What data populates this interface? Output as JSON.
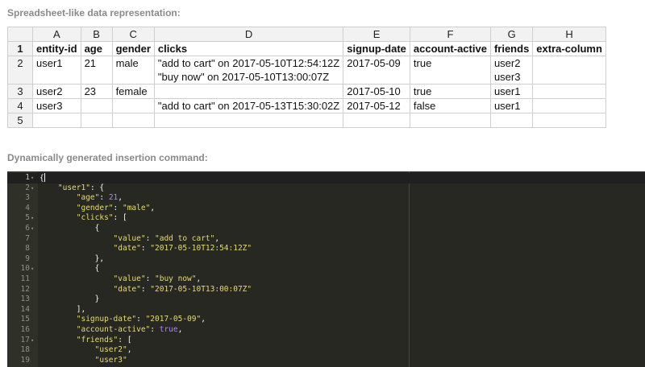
{
  "section1_title": "Spreadsheet-like data representation:",
  "section2_title": "Dynamically generated insertion command:",
  "spreadsheet": {
    "columns": [
      "A",
      "B",
      "C",
      "D",
      "E",
      "F",
      "G",
      "H"
    ],
    "rows": [
      {
        "num": "1",
        "cells": [
          "entity-id",
          "age",
          "gender",
          "clicks",
          "signup-date",
          "account-active",
          "friends",
          "extra-column"
        ]
      },
      {
        "num": "2",
        "cells": [
          "user1",
          "21",
          "male",
          "\"add to cart\" on 2017-05-10T12:54:12Z\n\"buy now\" on 2017-05-10T13:00:07Z",
          "2017-05-09",
          "true",
          "user2\nuser3",
          ""
        ]
      },
      {
        "num": "3",
        "cells": [
          "user2",
          "23",
          "female",
          "",
          "2017-05-10",
          "true",
          "user1",
          ""
        ]
      },
      {
        "num": "4",
        "cells": [
          "user3",
          "",
          "",
          "\"add to cart\" on 2017-05-13T15:30:02Z",
          "2017-05-12",
          "false",
          "user1",
          ""
        ]
      },
      {
        "num": "5",
        "cells": [
          "",
          "",
          "",
          "",
          "",
          "",
          "",
          ""
        ]
      }
    ]
  },
  "editor": {
    "lines": [
      {
        "num": "1",
        "fold": true,
        "tokens": [
          {
            "t": "p",
            "v": "{"
          }
        ]
      },
      {
        "num": "2",
        "fold": true,
        "tokens": [
          {
            "t": "p",
            "v": "    "
          },
          {
            "t": "s",
            "v": "\"user1\""
          },
          {
            "t": "p",
            "v": ": {"
          }
        ]
      },
      {
        "num": "3",
        "fold": false,
        "tokens": [
          {
            "t": "p",
            "v": "        "
          },
          {
            "t": "s",
            "v": "\"age\""
          },
          {
            "t": "p",
            "v": ": "
          },
          {
            "t": "n",
            "v": "21"
          },
          {
            "t": "p",
            "v": ","
          }
        ]
      },
      {
        "num": "4",
        "fold": false,
        "tokens": [
          {
            "t": "p",
            "v": "        "
          },
          {
            "t": "s",
            "v": "\"gender\""
          },
          {
            "t": "p",
            "v": ": "
          },
          {
            "t": "s",
            "v": "\"male\""
          },
          {
            "t": "p",
            "v": ","
          }
        ]
      },
      {
        "num": "5",
        "fold": true,
        "tokens": [
          {
            "t": "p",
            "v": "        "
          },
          {
            "t": "s",
            "v": "\"clicks\""
          },
          {
            "t": "p",
            "v": ": ["
          }
        ]
      },
      {
        "num": "6",
        "fold": true,
        "tokens": [
          {
            "t": "p",
            "v": "            {"
          }
        ]
      },
      {
        "num": "7",
        "fold": false,
        "tokens": [
          {
            "t": "p",
            "v": "                "
          },
          {
            "t": "s",
            "v": "\"value\""
          },
          {
            "t": "p",
            "v": ": "
          },
          {
            "t": "s",
            "v": "\"add to cart\""
          },
          {
            "t": "p",
            "v": ","
          }
        ]
      },
      {
        "num": "8",
        "fold": false,
        "tokens": [
          {
            "t": "p",
            "v": "                "
          },
          {
            "t": "s",
            "v": "\"date\""
          },
          {
            "t": "p",
            "v": ": "
          },
          {
            "t": "s",
            "v": "\"2017-05-10T12:54:12Z\""
          }
        ]
      },
      {
        "num": "9",
        "fold": false,
        "tokens": [
          {
            "t": "p",
            "v": "            },"
          }
        ]
      },
      {
        "num": "10",
        "fold": true,
        "tokens": [
          {
            "t": "p",
            "v": "            {"
          }
        ]
      },
      {
        "num": "11",
        "fold": false,
        "tokens": [
          {
            "t": "p",
            "v": "                "
          },
          {
            "t": "s",
            "v": "\"value\""
          },
          {
            "t": "p",
            "v": ": "
          },
          {
            "t": "s",
            "v": "\"buy now\""
          },
          {
            "t": "p",
            "v": ","
          }
        ]
      },
      {
        "num": "12",
        "fold": false,
        "tokens": [
          {
            "t": "p",
            "v": "                "
          },
          {
            "t": "s",
            "v": "\"date\""
          },
          {
            "t": "p",
            "v": ": "
          },
          {
            "t": "s",
            "v": "\"2017-05-10T13:00:07Z\""
          }
        ]
      },
      {
        "num": "13",
        "fold": false,
        "tokens": [
          {
            "t": "p",
            "v": "            }"
          }
        ]
      },
      {
        "num": "14",
        "fold": false,
        "tokens": [
          {
            "t": "p",
            "v": "        ],"
          }
        ]
      },
      {
        "num": "15",
        "fold": false,
        "tokens": [
          {
            "t": "p",
            "v": "        "
          },
          {
            "t": "s",
            "v": "\"signup-date\""
          },
          {
            "t": "p",
            "v": ": "
          },
          {
            "t": "s",
            "v": "\"2017-05-09\""
          },
          {
            "t": "p",
            "v": ","
          }
        ]
      },
      {
        "num": "16",
        "fold": false,
        "tokens": [
          {
            "t": "p",
            "v": "        "
          },
          {
            "t": "s",
            "v": "\"account-active\""
          },
          {
            "t": "p",
            "v": ": "
          },
          {
            "t": "b",
            "v": "true"
          },
          {
            "t": "p",
            "v": ","
          }
        ]
      },
      {
        "num": "17",
        "fold": true,
        "tokens": [
          {
            "t": "p",
            "v": "        "
          },
          {
            "t": "s",
            "v": "\"friends\""
          },
          {
            "t": "p",
            "v": ": ["
          }
        ]
      },
      {
        "num": "18",
        "fold": false,
        "tokens": [
          {
            "t": "p",
            "v": "            "
          },
          {
            "t": "s",
            "v": "\"user2\""
          },
          {
            "t": "p",
            "v": ","
          }
        ]
      },
      {
        "num": "19",
        "fold": false,
        "tokens": [
          {
            "t": "p",
            "v": "            "
          },
          {
            "t": "s",
            "v": "\"user3\""
          }
        ]
      }
    ]
  },
  "colors": {
    "editor_bg": "#272822",
    "string": "#e6db74",
    "number": "#ae81ff",
    "title": "#8a8a8a"
  }
}
